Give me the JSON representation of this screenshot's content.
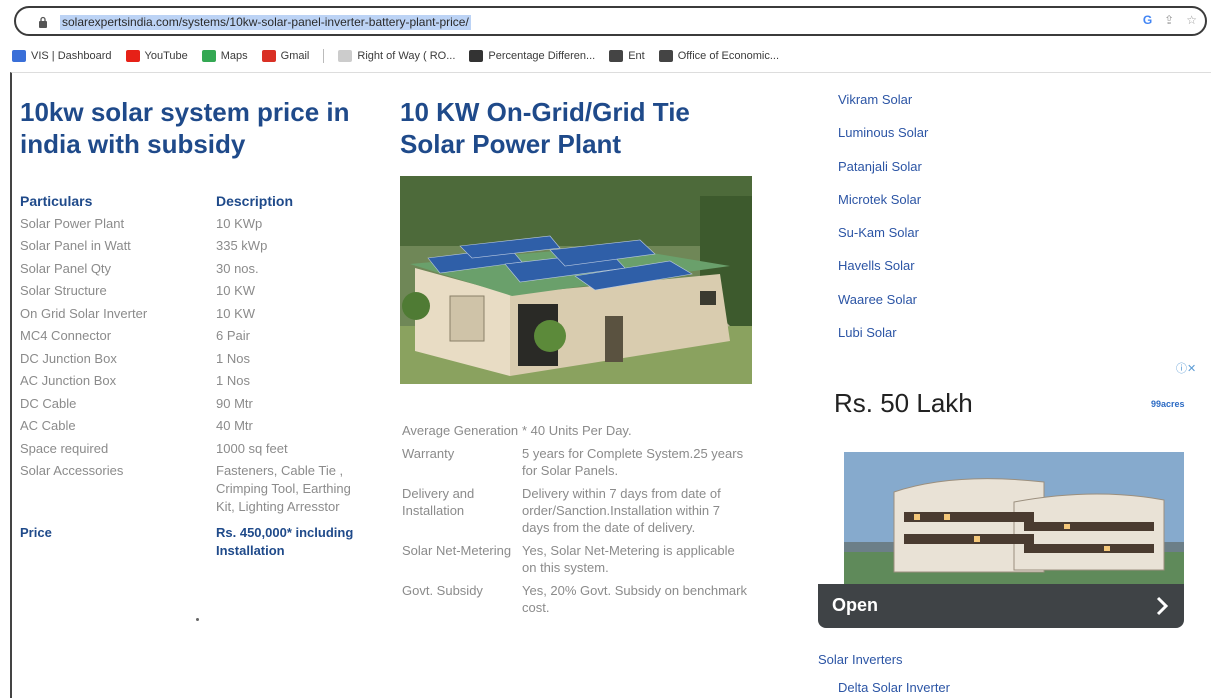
{
  "browser": {
    "url": "solarexpertsindia.com/systems/10kw-solar-panel-inverter-battery-plant-price/",
    "icons": [
      "google-icon",
      "share-icon",
      "star-icon"
    ],
    "bookmarks": [
      {
        "label": "VIS | Dashboard",
        "icon": "vis-icon",
        "color": "#3a6fd8"
      },
      {
        "label": "YouTube",
        "icon": "youtube-icon",
        "color": "#e62117"
      },
      {
        "label": "Maps",
        "icon": "maps-icon",
        "color": "#34a853"
      },
      {
        "label": "Gmail",
        "icon": "gmail-icon",
        "color": "#d93025"
      },
      {
        "label": "Right of Way ( RO...",
        "icon": "doc-icon",
        "color": "#cccccc"
      },
      {
        "label": "Percentage Differen...",
        "icon": "sigma-icon",
        "color": "#333333"
      },
      {
        "label": "Ent",
        "icon": "globe-icon",
        "color": "#444444"
      },
      {
        "label": "Office of Economic...",
        "icon": "globe-icon",
        "color": "#444444"
      }
    ]
  },
  "left": {
    "title": "10kw solar system price in india with subsidy",
    "header": {
      "k": "Particulars",
      "v": "Description"
    },
    "rows": [
      {
        "k": "Solar Power Plant",
        "v": "10 KWp"
      },
      {
        "k": "Solar Panel in Watt",
        "v": "335 kWp"
      },
      {
        "k": "Solar Panel Qty",
        "v": "30 nos."
      },
      {
        "k": "Solar Structure",
        "v": "10 KW"
      },
      {
        "k": "On Grid Solar Inverter",
        "v": "10 KW"
      },
      {
        "k": "MC4 Connector",
        "v": "6 Pair"
      },
      {
        "k": "DC Junction Box",
        "v": "1 Nos"
      },
      {
        "k": "AC Junction Box",
        "v": "1 Nos"
      },
      {
        "k": "DC Cable",
        "v": "90 Mtr"
      },
      {
        "k": "AC Cable",
        "v": "40 Mtr"
      },
      {
        "k": "Space required",
        "v": "1000 sq feet"
      },
      {
        "k": "Solar Accessories",
        "v": "Fasteners, Cable Tie , Crimping Tool, Earthing Kit, Lighting Arresstor"
      }
    ],
    "price": {
      "k": "Price",
      "v": "Rs. 450,000* including Installation"
    }
  },
  "middle": {
    "title": "10 KW On-Grid/Grid Tie Solar Power Plant",
    "details": [
      {
        "k": "Average Generation",
        "v": "* 40 Units Per Day."
      },
      {
        "k": "Warranty",
        "v": "5 years for Complete System.25 years for Solar Panels."
      },
      {
        "k": "Delivery and Installation",
        "v": "Delivery within 7 days from date of order/Sanction.Installation within 7 days from the date of delivery."
      },
      {
        "k": "Solar Net-Metering",
        "v": "Yes, Solar Net-Metering is applicable on this system."
      },
      {
        "k": "Govt. Subsidy",
        "v": "Yes, 20% Govt. Subsidy on benchmark cost."
      }
    ]
  },
  "right": {
    "brands": [
      "Vikram Solar",
      "Luminous Solar",
      "Patanjali Solar",
      "Microtek Solar",
      "Su-Kam Solar",
      "Havells Solar",
      "Waaree Solar",
      "Lubi Solar"
    ],
    "ad": {
      "price": "Rs. 50 Lakh",
      "brand": "99acres",
      "open_label": "Open"
    },
    "inverters_heading": "Solar Inverters",
    "inverters": [
      "Delta Solar Inverter"
    ]
  }
}
